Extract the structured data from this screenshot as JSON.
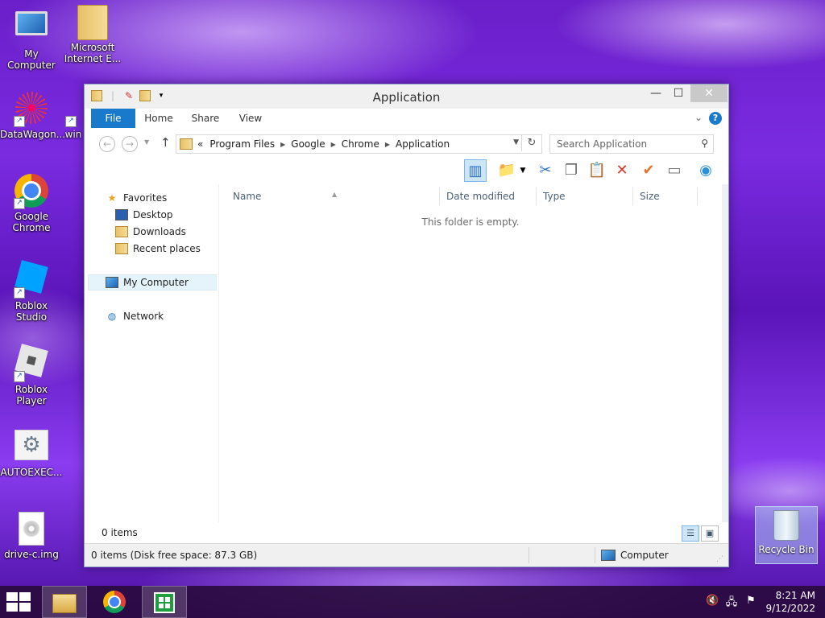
{
  "desktop": {
    "icons": [
      {
        "label": "My Computer"
      },
      {
        "label": "Microsoft Internet E..."
      },
      {
        "label": "DataWagon..."
      },
      {
        "label": "win"
      },
      {
        "label": "Google Chrome"
      },
      {
        "label": "Roblox Studio"
      },
      {
        "label": "Roblox Player"
      },
      {
        "label": "AUTOEXEC..."
      },
      {
        "label": "drive-c.img"
      }
    ],
    "recycle_bin": "Recycle Bin"
  },
  "window": {
    "title": "Application",
    "tabs": [
      "File",
      "Home",
      "Share",
      "View"
    ],
    "breadcrumb_prefix": "«",
    "breadcrumb": [
      "Program Files",
      "Google",
      "Chrome",
      "Application"
    ],
    "search_placeholder": "Search Application",
    "nav": {
      "favorites": "Favorites",
      "desktop": "Desktop",
      "downloads": "Downloads",
      "recent": "Recent places",
      "computer": "My Computer",
      "network": "Network"
    },
    "columns": [
      "Name",
      "Date modified",
      "Type",
      "Size"
    ],
    "empty_message": "This folder is empty.",
    "item_count": "0 items",
    "status_left": "0 items (Disk free space: 87.3 GB)",
    "status_right": "Computer"
  },
  "taskbar": {
    "time": "8:21 AM",
    "date": "9/12/2022"
  }
}
